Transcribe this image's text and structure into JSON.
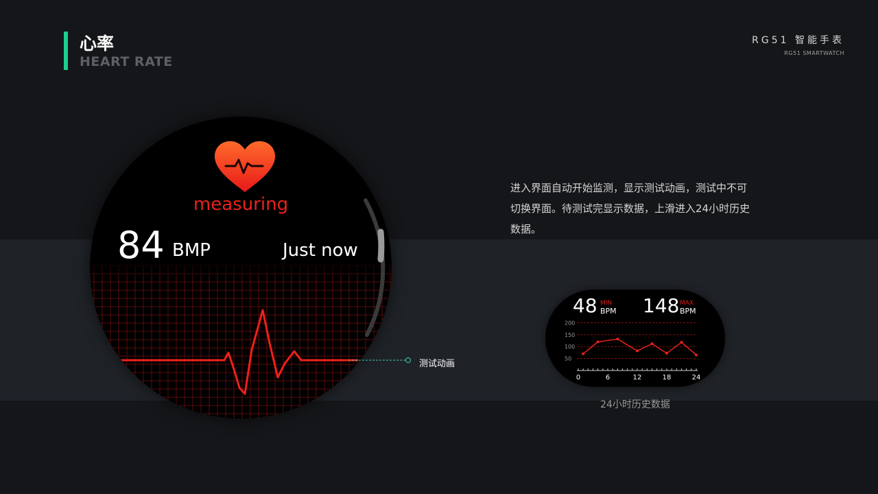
{
  "header": {
    "title_cn": "心率",
    "title_en": "HEART RATE",
    "brand_cn": "RG51 智能手表",
    "brand_en": "RG51 SMARTWATCH"
  },
  "description": "进入界面自动开始监测，显示测试动画，测试中不可切换界面。待测试完显示数据，上滑进入24小时历史数据。",
  "watch": {
    "status": "measuring",
    "bpm_value": "84",
    "bpm_unit": "BMP",
    "time": "Just now",
    "accent_color": "#e8231a"
  },
  "annotation": {
    "label": "测试动画",
    "line_color": "#3fd0b0"
  },
  "history_widget": {
    "min_value": "48",
    "min_tag": "MIN",
    "min_unit": "BPM",
    "max_value": "148",
    "max_tag": "MAX",
    "max_unit": "BPM",
    "caption": "24小时历史数据"
  },
  "chart_data": {
    "type": "line",
    "x": [
      1,
      4,
      8,
      12,
      15,
      18,
      21,
      24
    ],
    "values": [
      70,
      120,
      132,
      82,
      112,
      72,
      118,
      65
    ],
    "xticks": [
      "0",
      "6",
      "12",
      "18",
      "24"
    ],
    "yticks": [
      "200",
      "150",
      "100",
      "50"
    ],
    "xlim": [
      0,
      24
    ],
    "ylim": [
      40,
      210
    ],
    "grid": true,
    "line_color": "#e8231a"
  }
}
